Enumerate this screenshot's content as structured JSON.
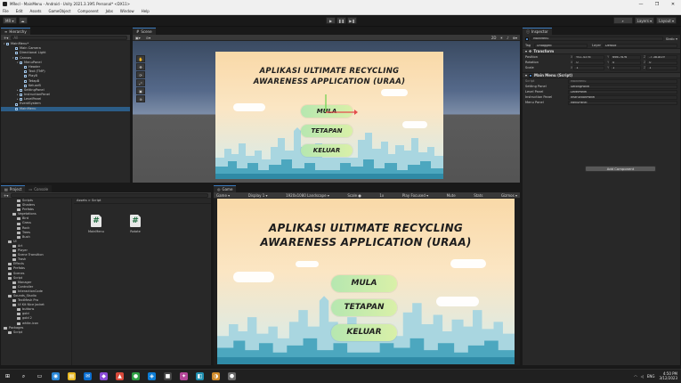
{
  "window": {
    "title": "MRecl - MainMenu - Android - Unity 2021.3.19f1 Personal* <DX11>",
    "controls": [
      "—",
      "❐",
      "✕"
    ]
  },
  "menu": [
    "File",
    "Edit",
    "Assets",
    "GameObject",
    "Component",
    "Jobs",
    "Window",
    "Help"
  ],
  "toolbar": {
    "account_label": "MR ▾",
    "play_icons": [
      "▶",
      "❚❚",
      "▶❚"
    ],
    "right_buttons": [
      "Layers ▾",
      "Layout ▾"
    ]
  },
  "hierarchy": {
    "tab": "Hierarchy",
    "search_placeholder": "All",
    "rows": [
      {
        "label": "MainMenu*",
        "depth": 0,
        "arrow": "▾",
        "selected": false
      },
      {
        "label": "Main Camera",
        "depth": 2,
        "arrow": "",
        "selected": false
      },
      {
        "label": "Directional Light",
        "depth": 2,
        "arrow": "",
        "selected": false
      },
      {
        "label": "Canvas",
        "depth": 2,
        "arrow": "▾",
        "selected": false
      },
      {
        "label": "MenuPanel",
        "depth": 3,
        "arrow": "▾",
        "selected": false
      },
      {
        "label": "Header",
        "depth": 4,
        "arrow": "",
        "selected": false
      },
      {
        "label": "Text (TMP)",
        "depth": 4,
        "arrow": "",
        "selected": false
      },
      {
        "label": "PlayB",
        "depth": 4,
        "arrow": "",
        "selected": false
      },
      {
        "label": "TetapB",
        "depth": 4,
        "arrow": "",
        "selected": false
      },
      {
        "label": "KeluarB",
        "depth": 4,
        "arrow": "",
        "selected": false
      },
      {
        "label": "SettingPanel",
        "depth": 3,
        "arrow": "▸",
        "selected": false
      },
      {
        "label": "InstructionPanel",
        "depth": 3,
        "arrow": "▸",
        "selected": false
      },
      {
        "label": "LevelPanel",
        "depth": 3,
        "arrow": "▸",
        "selected": false
      },
      {
        "label": "EventSystem",
        "depth": 2,
        "arrow": "",
        "selected": false
      },
      {
        "label": "MainMenu",
        "depth": 2,
        "arrow": "",
        "selected": true
      }
    ]
  },
  "scene": {
    "tab": "Scene",
    "tools": [
      "✋",
      "✥",
      "⟳",
      "⤢",
      "▣",
      "⊕"
    ]
  },
  "game": {
    "tab": "Game",
    "bar": [
      "Game ▾",
      "Display 1 ▾",
      "1920x1080 Landscape ▾",
      "Scale ●",
      "1x",
      "Play Focused ▾",
      "Mute",
      "Stats",
      "Gizmos ▾"
    ],
    "title_line1": "APLIKASI ULTIMATE RECYCLING",
    "title_line2": "AWARENESS APPLICATION (URAA)",
    "buttons": [
      "MULA",
      "TETAPAN",
      "KELUAR"
    ]
  },
  "project": {
    "tabs": [
      "Project",
      "Console"
    ],
    "breadcrumb": "Assets > Script",
    "tree": [
      {
        "label": "Scripts",
        "depth": 3
      },
      {
        "label": "Shaders",
        "depth": 3
      },
      {
        "label": "Prefabs",
        "depth": 3
      },
      {
        "label": "Vegetations",
        "depth": 2
      },
      {
        "label": "Bird",
        "depth": 3
      },
      {
        "label": "Grass",
        "depth": 3
      },
      {
        "label": "Rock",
        "depth": 3
      },
      {
        "label": "Trees",
        "depth": 3
      },
      {
        "label": "Bush",
        "depth": 3
      },
      {
        "label": "UI",
        "depth": 1
      },
      {
        "label": "Art",
        "depth": 2
      },
      {
        "label": "Player",
        "depth": 2
      },
      {
        "label": "Scene Transition",
        "depth": 2
      },
      {
        "label": "Trash",
        "depth": 2
      },
      {
        "label": "Effects",
        "depth": 1
      },
      {
        "label": "Prefabs",
        "depth": 1
      },
      {
        "label": "Scenes",
        "depth": 1
      },
      {
        "label": "Script",
        "depth": 1
      },
      {
        "label": "Manager",
        "depth": 2
      },
      {
        "label": "Controller",
        "depth": 2
      },
      {
        "label": "InteractionCode",
        "depth": 2
      },
      {
        "label": "Sounds_Studio",
        "depth": 1
      },
      {
        "label": "TextMesh Pro",
        "depth": 2
      },
      {
        "label": "UI Kit Nice Jacket",
        "depth": 2
      },
      {
        "label": "buttons",
        "depth": 3
      },
      {
        "label": "gold",
        "depth": 3
      },
      {
        "label": "gold 2",
        "depth": 3
      },
      {
        "label": "white-icon",
        "depth": 3
      },
      {
        "label": "Packages",
        "depth": 0
      },
      {
        "label": "Script",
        "depth": 1
      }
    ],
    "files": [
      {
        "name": "MainMenu",
        "glyph": "#"
      },
      {
        "name": "Rotate",
        "glyph": "#"
      }
    ]
  },
  "inspector": {
    "tab": "Inspector",
    "object_name": "MainMenu",
    "static_label": "Static ▾",
    "tag_label": "Tag",
    "tag_value": "Untagged",
    "layer_label": "Layer",
    "layer_value": "Default",
    "transform_header": "Transform",
    "transform": [
      {
        "label": "Position",
        "x": "911.4376",
        "y": "666.7876",
        "z": "-7.381819"
      },
      {
        "label": "Rotation",
        "x": "0",
        "y": "0",
        "z": "0"
      },
      {
        "label": "Scale",
        "x": "1",
        "y": "1",
        "z": "1"
      }
    ],
    "script_header": "Main Menu (Script)",
    "script_label": "Script",
    "script_value": "MainMenu",
    "fields": [
      {
        "label": "Setting Panel",
        "value": "SettingPanel"
      },
      {
        "label": "Level Panel",
        "value": "LevelPanel"
      },
      {
        "label": "Instruction Panel",
        "value": "InstructionPanel"
      },
      {
        "label": "Menu Panel",
        "value": "MenuPanel"
      }
    ],
    "add_component": "Add Component"
  },
  "taskbar": {
    "icons": [
      "⊞",
      "⌕",
      "▭",
      "◉",
      "▤",
      "✉",
      "◆",
      "▲",
      "●",
      "◈",
      "■",
      "✦",
      "◧",
      "◑",
      "⬣"
    ],
    "time": "4:50 PM",
    "date": "3/12/2023",
    "lang": "ENG"
  },
  "colors": {
    "accent": "#3a79bb",
    "selected_row": "#2c5d87",
    "panel_bg": "#282828",
    "button_green": "#b6e7b0"
  }
}
